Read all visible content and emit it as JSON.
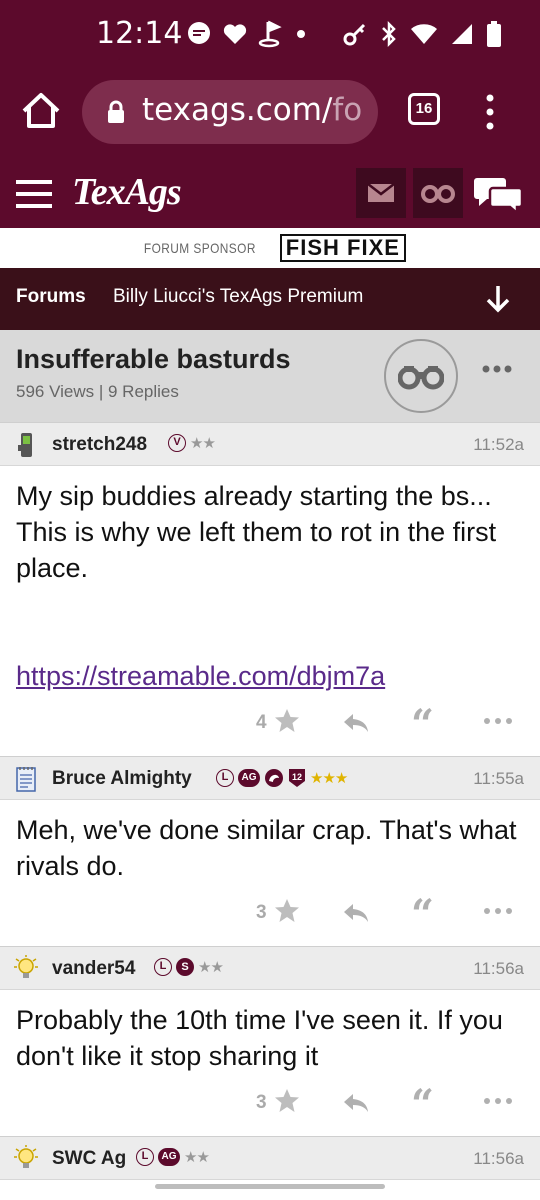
{
  "status": {
    "time": "12:14"
  },
  "browser": {
    "url_main": "texags.com/",
    "url_dim": "fo",
    "tab_count": "16"
  },
  "site": {
    "logo": "TexAgs"
  },
  "sponsor": {
    "label": "FORUM SPONSOR",
    "brand": "FISH FIXE"
  },
  "forumbar": {
    "forums_label": "Forums",
    "board": "Billy Liucci's TexAgs Premium"
  },
  "thread": {
    "title": "Insufferable basturds",
    "meta": "596 Views | 9 Replies"
  },
  "posts": [
    {
      "username": "stretch248",
      "time": "11:52a",
      "badges": [
        "V"
      ],
      "stars": "★★",
      "body": "My sip buddies already starting the bs... This is why we left them to rot in the first place.",
      "link": "https://streamable.com/dbjm7a",
      "score": "4"
    },
    {
      "username": "Bruce Almighty",
      "time": "11:55a",
      "badges": [
        "L",
        "AG",
        "12"
      ],
      "stars": "★★★",
      "body": "Meh, we've done similar crap. That's what rivals do.",
      "score": "3"
    },
    {
      "username": "vander54",
      "time": "11:56a",
      "badges": [
        "L",
        "S"
      ],
      "stars": "★★",
      "body": "Probably the 10th time I've seen it. If you don't like it stop sharing it",
      "score": "3"
    },
    {
      "username": "SWC Ag",
      "time": "11:56a",
      "badges": [
        "L",
        "AG"
      ],
      "stars": "★★"
    }
  ],
  "colors": {
    "maroon": "#5c0a2c",
    "dark": "#3a1019",
    "gold": "#e0b400"
  }
}
